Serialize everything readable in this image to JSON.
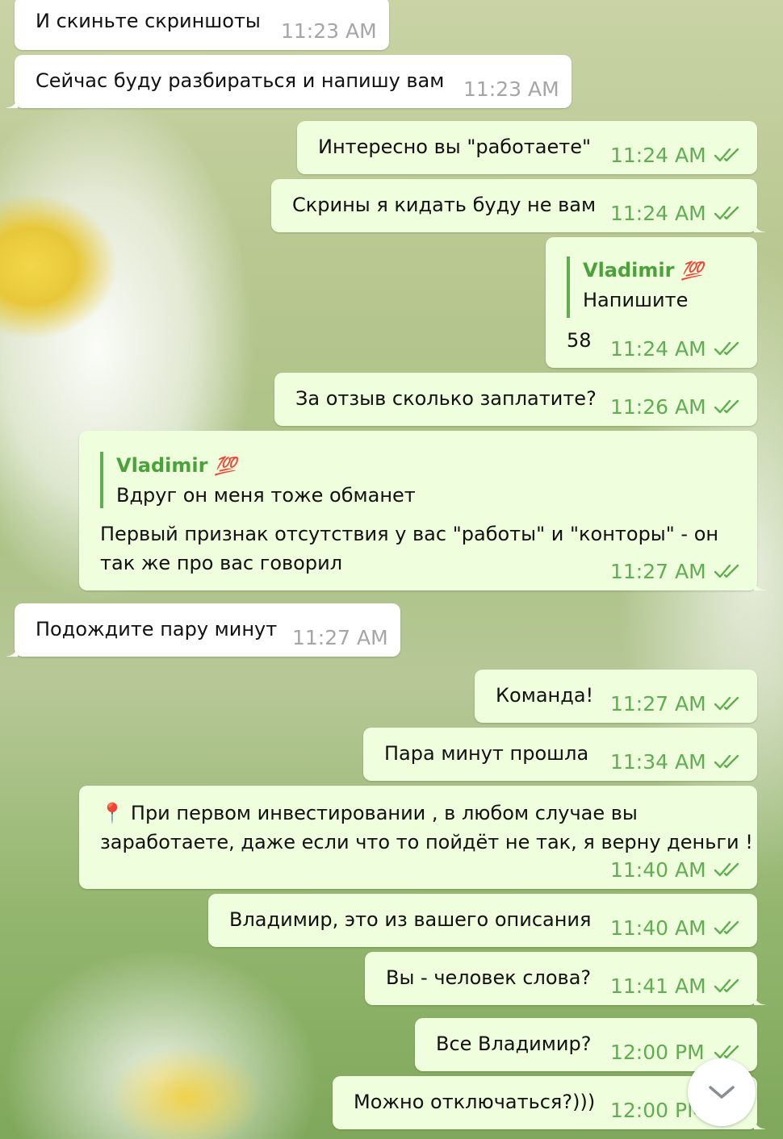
{
  "messages": [
    {
      "text": "И скиньте скриншоты",
      "time": "11:23 AM"
    },
    {
      "text": "Сейчас буду разбираться и напишу вам",
      "time": "11:23 AM"
    },
    {
      "text": "Интересно вы \"работаете\"",
      "time": "11:24 AM"
    },
    {
      "text": "Скрины я кидать буду не вам",
      "time": "11:24 AM"
    },
    {
      "reply_name": "Vladimir",
      "reply_emoji": "💯",
      "reply_text": "Напишите",
      "text": "58",
      "time": "11:24 AM"
    },
    {
      "text": "За отзыв сколько заплатите?",
      "time": "11:26 AM"
    },
    {
      "reply_name": "Vladimir",
      "reply_emoji": "💯",
      "reply_text": "Вдруг он меня тоже обманет",
      "text_line1": "Первый признак отсутствия у вас \"работы\" и \"конторы\" - он",
      "text_line2": "так же про вас говорил",
      "time": "11:27 AM"
    },
    {
      "text": "Подождите пару минут",
      "time": "11:27 AM"
    },
    {
      "text": "Команда!",
      "time": "11:27 AM"
    },
    {
      "text": "Пара минут прошла",
      "time": "11:34 AM"
    },
    {
      "pin_icon": "📍",
      "text_line1": "При первом инвестировании , в любом случае вы",
      "text_line2": "заработаете, даже если что то пойдёт не так, я верну деньги !",
      "time": "11:40 AM"
    },
    {
      "text": "Владимир, это из вашего описания",
      "time": "11:40 AM"
    },
    {
      "text": "Вы - человек слова?",
      "time": "11:41 AM"
    },
    {
      "text": "Все Владимир?",
      "time": "12:00 PM"
    },
    {
      "text": "Можно отключаться?)))",
      "time": "12:00 PM"
    }
  ],
  "colors": {
    "incoming_bubble": "#ffffff",
    "outgoing_bubble": "#effedd",
    "outgoing_time": "#5fae4f",
    "incoming_time": "#a6a6a6",
    "reply_accent": "#5fae4f"
  },
  "icons": {
    "read_receipt": "double-check-icon",
    "scroll_down": "chevron-down-icon"
  }
}
